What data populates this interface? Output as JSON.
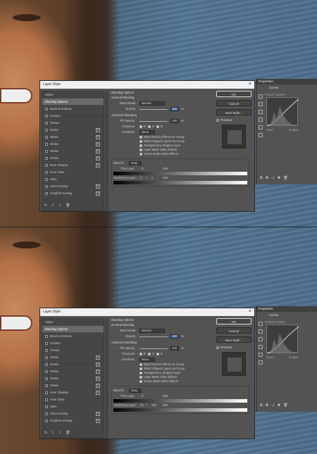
{
  "screens": [
    {
      "id": "top",
      "layer_style": {
        "title": "Layer Style",
        "close": "×",
        "styles": [
          {
            "label": "Styles",
            "selected": false,
            "checkbox": false,
            "plus": false
          },
          {
            "label": "Blending Options",
            "selected": true,
            "checkbox": false,
            "plus": false
          },
          {
            "label": "Bevel & Emboss",
            "selected": false,
            "checkbox": true,
            "plus": false
          },
          {
            "label": "Contour",
            "selected": false,
            "checkbox": true,
            "plus": false
          },
          {
            "label": "Texture",
            "selected": false,
            "checkbox": true,
            "plus": false
          },
          {
            "label": "Stroke",
            "selected": false,
            "checkbox": true,
            "plus": true
          },
          {
            "label": "Stroke",
            "selected": false,
            "checkbox": true,
            "plus": true
          },
          {
            "label": "Stroke",
            "selected": false,
            "checkbox": true,
            "plus": true
          },
          {
            "label": "Stroke",
            "selected": false,
            "checkbox": true,
            "plus": true
          },
          {
            "label": "Stroke",
            "selected": false,
            "checkbox": true,
            "plus": true
          },
          {
            "label": "Inner Shadow",
            "selected": false,
            "checkbox": true,
            "plus": true
          },
          {
            "label": "Inner Glow",
            "selected": false,
            "checkbox": true,
            "plus": false
          },
          {
            "label": "Satin",
            "selected": false,
            "checkbox": true,
            "plus": false
          },
          {
            "label": "Color Overlay",
            "selected": false,
            "checkbox": true,
            "plus": true
          },
          {
            "label": "Gradient Overlay",
            "selected": false,
            "checkbox": true,
            "plus": true
          }
        ],
        "fx_bar": [
          "fx",
          "⇧",
          "⇩",
          "🗑"
        ],
        "blending": {
          "section": "Blending Options",
          "general": "General Blending",
          "blend_mode_label": "Blend Mode:",
          "blend_mode_value": "Normal",
          "opacity_label": "Opacity:",
          "opacity_value": "100",
          "percent": "%",
          "advanced": "Advanced Blending",
          "fill_opacity_label": "Fill Opacity:",
          "fill_opacity_value": "100",
          "channels_label": "Channels:",
          "channels": [
            "R",
            "G",
            "B"
          ],
          "knockout_label": "Knockout:",
          "knockout_value": "None",
          "options": [
            "Blend Interior Effects as Group",
            "Blend Clipped Layers as Group",
            "Transparency Shapes Layer",
            "Layer Mask Hides Effects",
            "Vector Mask Hides Effects"
          ],
          "blend_if_label": "Blend If:",
          "blend_if_value": "Gray",
          "this_layer_label": "This Layer:",
          "this_layer_values": [
            "0",
            "255"
          ],
          "underlying_label": "Underlying Layer:",
          "underlying_values": [
            "0",
            "/",
            "1",
            "",
            "255"
          ]
        },
        "buttons": {
          "ok": "OK",
          "cancel": "Cancel",
          "new_style": "New Style...",
          "preview": "Preview"
        }
      },
      "properties": {
        "tab": "Properties",
        "type": "Curves",
        "preset": "Preset:  Custom",
        "channel": "RGB",
        "auto": "Auto",
        "input": "Input:",
        "output": "Output:",
        "bottom_icons": "⧉ ◉ ↺ ◉ 🗑"
      }
    },
    {
      "id": "bottom",
      "layer_style": {
        "title": "Layer Style",
        "close": "×",
        "styles": [
          {
            "label": "Styles",
            "selected": false,
            "checkbox": false,
            "plus": false
          },
          {
            "label": "Blending Options",
            "selected": true,
            "checkbox": false,
            "plus": false
          },
          {
            "label": "Bevel & Emboss",
            "selected": false,
            "checkbox": true,
            "plus": false
          },
          {
            "label": "Contour",
            "selected": false,
            "checkbox": true,
            "plus": false
          },
          {
            "label": "Texture",
            "selected": false,
            "checkbox": true,
            "plus": false
          },
          {
            "label": "Stroke",
            "selected": false,
            "checkbox": true,
            "plus": true
          },
          {
            "label": "Stroke",
            "selected": false,
            "checkbox": true,
            "plus": true
          },
          {
            "label": "Stroke",
            "selected": false,
            "checkbox": true,
            "plus": true
          },
          {
            "label": "Stroke",
            "selected": false,
            "checkbox": true,
            "plus": true
          },
          {
            "label": "Stroke",
            "selected": false,
            "checkbox": true,
            "plus": true
          },
          {
            "label": "Inner Shadow",
            "selected": false,
            "checkbox": true,
            "plus": true
          },
          {
            "label": "Inner Glow",
            "selected": false,
            "checkbox": true,
            "plus": false
          },
          {
            "label": "Satin",
            "selected": false,
            "checkbox": true,
            "plus": false
          },
          {
            "label": "Color Overlay",
            "selected": false,
            "checkbox": true,
            "plus": true
          },
          {
            "label": "Gradient Overlay",
            "selected": false,
            "checkbox": true,
            "plus": true
          }
        ],
        "fx_bar": [
          "fx",
          "⇧",
          "⇩",
          "🗑"
        ],
        "blending": {
          "section": "Blending Options",
          "general": "General Blending",
          "blend_mode_label": "Blend Mode:",
          "blend_mode_value": "Normal",
          "opacity_label": "Opacity:",
          "opacity_value": "100",
          "percent": "%",
          "advanced": "Advanced Blending",
          "fill_opacity_label": "Fill Opacity:",
          "fill_opacity_value": "100",
          "channels_label": "Channels:",
          "channels": [
            "R",
            "G",
            "B"
          ],
          "knockout_label": "Knockout:",
          "knockout_value": "None",
          "options": [
            "Blend Interior Effects as Group",
            "Blend Clipped Layers as Group",
            "Transparency Shapes Layer",
            "Layer Mask Hides Effects",
            "Vector Mask Hides Effects"
          ],
          "blend_if_label": "Blend If:",
          "blend_if_value": "Gray",
          "this_layer_label": "This Layer:",
          "this_layer_values": [
            "0",
            "255"
          ],
          "underlying_label": "Underlying Layer:",
          "underlying_values": [
            "76",
            "/",
            "230",
            "",
            "255"
          ]
        },
        "buttons": {
          "ok": "OK",
          "cancel": "Cancel",
          "new_style": "New Style...",
          "preview": "Preview"
        }
      },
      "properties": {
        "tab": "Properties",
        "type": "Curves",
        "preset": "Preset:  Custom",
        "channel": "RGB",
        "auto": "Auto",
        "input": "Input:",
        "output": "Output:",
        "bottom_icons": "⧉ ◉ ↺ ◉ 🗑"
      }
    }
  ]
}
